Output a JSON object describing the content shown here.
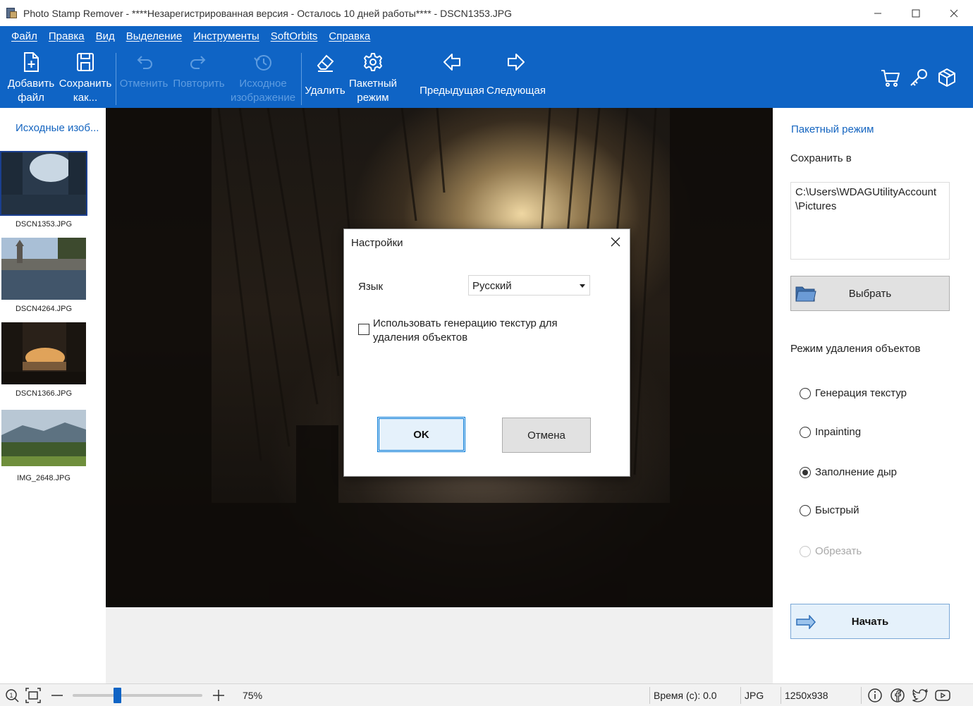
{
  "window": {
    "title": "Photo Stamp Remover - ****Незарегистрированная версия - Осталось 10 дней работы**** - DSCN1353.JPG"
  },
  "menu": [
    "Файл",
    "Правка",
    "Вид",
    "Выделение",
    "Инструменты",
    "SoftOrbits",
    "Справка"
  ],
  "toolbar": {
    "add_file": "Добавить\nфайл",
    "save_as": "Сохранить\nкак...",
    "undo": "Отменить",
    "redo": "Повторить",
    "original_image": "Исходное\nизображение",
    "remove": "Удалить",
    "batch_mode": "Пакетный\nрежим",
    "previous": "Предыдущая",
    "next": "Следующая"
  },
  "left_panel": {
    "title": "Исходные изоб...",
    "thumbnails": [
      {
        "name": "DSCN1353.JPG",
        "selected": true
      },
      {
        "name": "DSCN4264.JPG",
        "selected": false
      },
      {
        "name": "DSCN1366.JPG",
        "selected": false
      },
      {
        "name": "IMG_2648.JPG",
        "selected": false
      }
    ]
  },
  "dialog": {
    "title": "Настройки",
    "language_label": "Язык",
    "language_value": "Русский",
    "texture_checkbox_label": "Использовать генерацию текстур для удаления объектов",
    "texture_checked": false,
    "ok_label": "OK",
    "cancel_label": "Отмена"
  },
  "right_panel": {
    "title": "Пакетный режим",
    "save_to_label": "Сохранить в",
    "save_path": "C:\\Users\\WDAGUtilityAccount\\Pictures",
    "choose_button": "Выбрать",
    "mode_label": "Режим удаления объектов",
    "modes": [
      {
        "label": "Генерация текстур",
        "selected": false,
        "disabled": false
      },
      {
        "label": "Inpainting",
        "selected": false,
        "disabled": false
      },
      {
        "label": "Заполнение дыр",
        "selected": true,
        "disabled": false
      },
      {
        "label": "Быстрый",
        "selected": false,
        "disabled": false
      },
      {
        "label": "Обрезать",
        "selected": false,
        "disabled": true
      }
    ],
    "start_button": "Начать"
  },
  "statusbar": {
    "zoom": "75%",
    "zoom_fraction": 0.34,
    "time": "Время (с): 0.0",
    "format": "JPG",
    "dimensions": "1250x938"
  },
  "colors": {
    "ribbon": "#0f64c5",
    "accent_text": "#1565c0"
  }
}
